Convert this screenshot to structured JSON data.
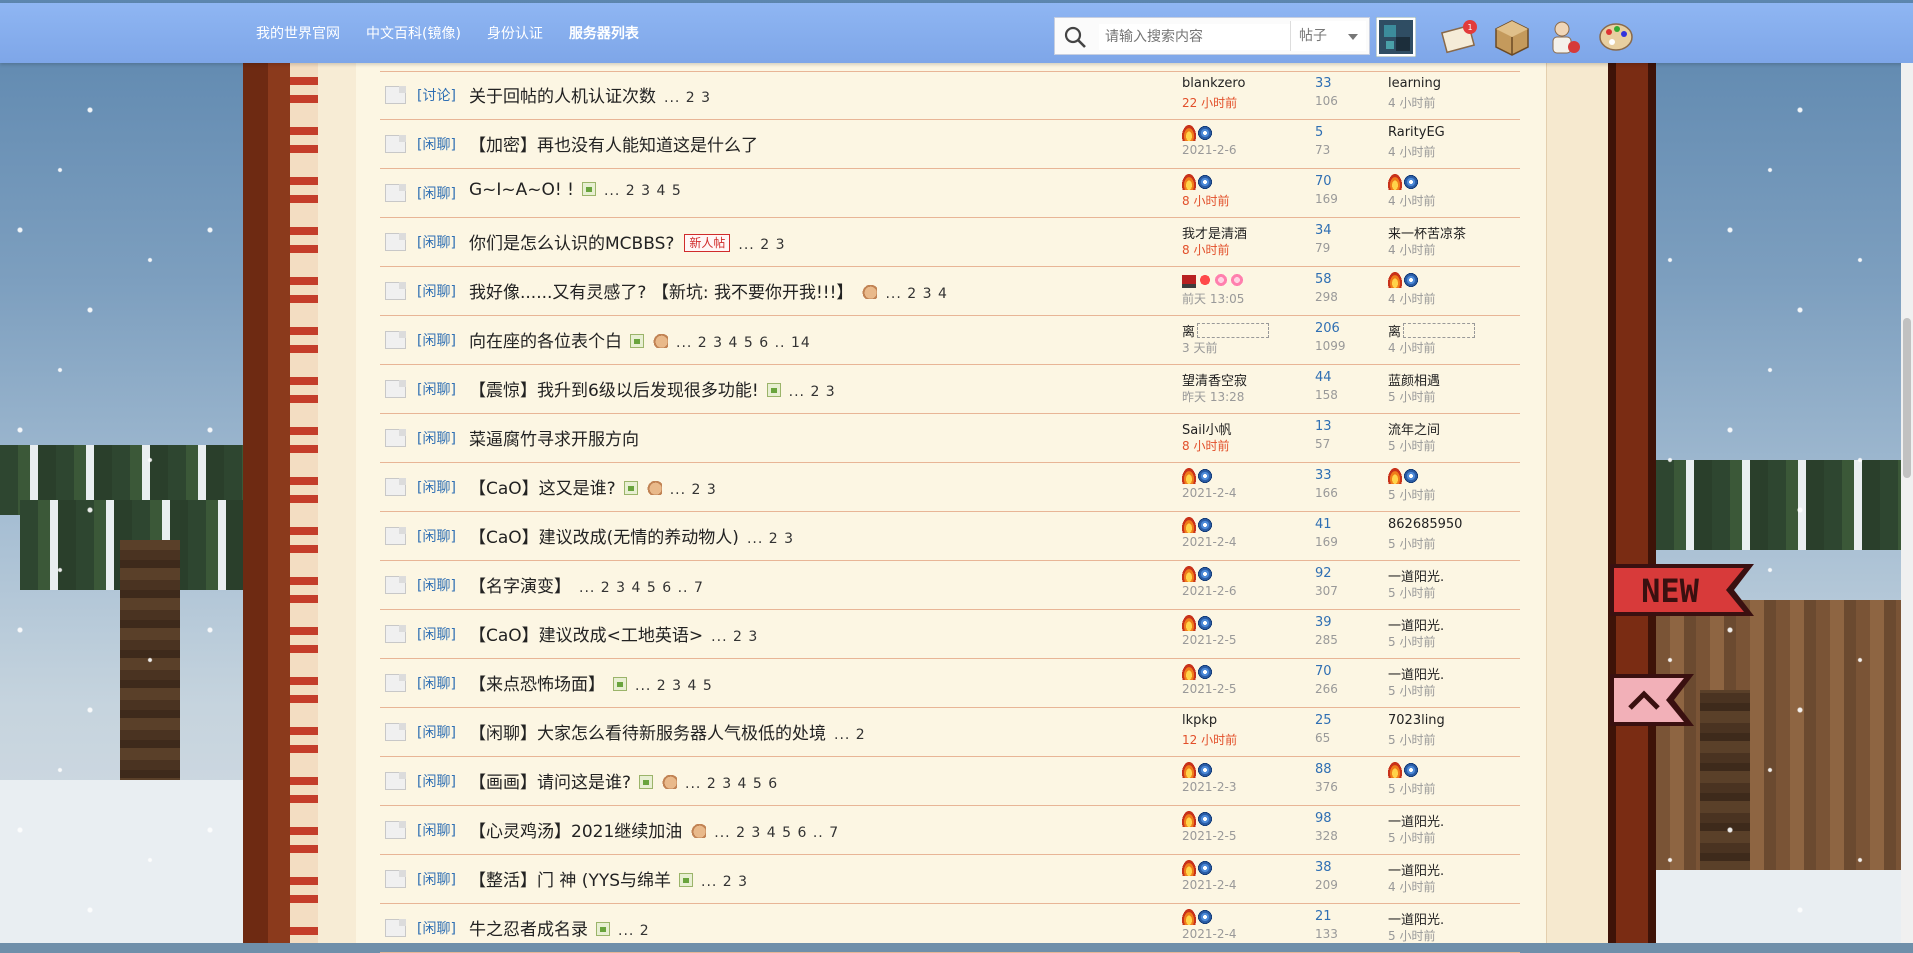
{
  "nav": {
    "links": [
      "我的世界官网",
      "中文百科(镜像)",
      "身份认证",
      "服务器列表"
    ],
    "search_placeholder": "请输入搜索内容",
    "search_type": "帖子"
  },
  "threads": [
    {
      "category": "[讨论]",
      "title": "关于回帖的人机认证次数",
      "pages": "... 2 3",
      "author": "blankzero",
      "author_date": "22 小时前",
      "author_date_red": true,
      "replies": "33",
      "views": "106",
      "last_poster": "learning",
      "last_date": "4 小时前"
    },
    {
      "category": "[闲聊]",
      "title": "【加密】再也没有人能知道这是什么了",
      "pages": "",
      "author": "",
      "author_medals": [
        "fire",
        "snow"
      ],
      "author_date": "2021-2-6",
      "author_date_red": false,
      "replies": "5",
      "views": "73",
      "last_poster": "RarityEG",
      "last_date": "4 小时前"
    },
    {
      "category": "[闲聊]",
      "title": "G~I~A~O! !",
      "img": true,
      "pages": "... 2 3 4 5",
      "author": "",
      "author_medals": [
        "fire",
        "snow"
      ],
      "author_date": "8 小时前",
      "author_date_red": true,
      "replies": "70",
      "views": "169",
      "last_poster": "",
      "last_medals": [
        "fire",
        "snow"
      ],
      "last_date": "4 小时前"
    },
    {
      "category": "[闲聊]",
      "title": "你们是怎么认识的MCBBS?",
      "newbie": "新人帖",
      "pages": "... 2 3",
      "author": "我才是清酒",
      "author_date": "8 小时前",
      "author_date_red": true,
      "replies": "34",
      "views": "79",
      "last_poster": "来一杯苦凉茶",
      "last_date": "4 小时前"
    },
    {
      "category": "[闲聊]",
      "title": "我好像......又有灵感了? 【新坑: 我不要你开我!!!】",
      "hand": true,
      "pages": "... 2 3 4",
      "author": "",
      "author_medals": [
        "boot",
        "heart",
        "flower",
        "flower"
      ],
      "author_date": "前天 13:05",
      "author_date_red": false,
      "replies": "58",
      "views": "298",
      "last_poster": "",
      "last_medals": [
        "fire",
        "snow"
      ],
      "last_date": "4 小时前"
    },
    {
      "category": "[闲聊]",
      "title": "向在座的各位表个白",
      "img": true,
      "hand": true,
      "pages": "... 2 3 4 5 6 .. 14",
      "author": "离",
      "author_boxes": true,
      "author_date": "3 天前",
      "author_date_red": false,
      "replies": "206",
      "views": "1099",
      "last_poster": "离",
      "last_boxes": true,
      "last_date": "4 小时前"
    },
    {
      "category": "[闲聊]",
      "title": "【震惊】我升到6级以后发现很多功能!",
      "img": true,
      "pages": "... 2 3",
      "author": "望清香空寂",
      "author_date": "昨天 13:28",
      "author_date_red": false,
      "replies": "44",
      "views": "158",
      "last_poster": "蓝颜相遇",
      "last_date": "5 小时前"
    },
    {
      "category": "[闲聊]",
      "title": "菜逼腐竹寻求开服方向",
      "pages": "",
      "author": "Sail小帆",
      "author_date": "8 小时前",
      "author_date_red": true,
      "replies": "13",
      "views": "57",
      "last_poster": "流年之间",
      "last_date": "5 小时前"
    },
    {
      "category": "[闲聊]",
      "title": "【CaO】这又是谁?",
      "img": true,
      "hand": true,
      "pages": "... 2 3",
      "author": "",
      "author_medals": [
        "fire",
        "snow"
      ],
      "author_date": "2021-2-4",
      "author_date_red": false,
      "replies": "33",
      "views": "166",
      "last_poster": "",
      "last_medals": [
        "fire",
        "snow"
      ],
      "last_date": "5 小时前"
    },
    {
      "category": "[闲聊]",
      "title": "【CaO】建议改成(无情的养动物人)",
      "pages": "... 2 3",
      "author": "",
      "author_medals": [
        "fire",
        "snow"
      ],
      "author_date": "2021-2-4",
      "author_date_red": false,
      "replies": "41",
      "views": "169",
      "last_poster": "862685950",
      "last_date": "5 小时前"
    },
    {
      "category": "[闲聊]",
      "title": "【名字演变】",
      "pages": "... 2 3 4 5 6 .. 7",
      "author": "",
      "author_medals": [
        "fire",
        "snow"
      ],
      "author_date": "2021-2-6",
      "author_date_red": false,
      "replies": "92",
      "views": "307",
      "last_poster": "一道阳光.",
      "last_date": "5 小时前"
    },
    {
      "category": "[闲聊]",
      "title": "【CaO】建议改成<工地英语>",
      "pages": "... 2 3",
      "author": "",
      "author_medals": [
        "fire",
        "snow"
      ],
      "author_date": "2021-2-5",
      "author_date_red": false,
      "replies": "39",
      "views": "285",
      "last_poster": "一道阳光.",
      "last_date": "5 小时前"
    },
    {
      "category": "[闲聊]",
      "title": "【来点恐怖场面】",
      "img": true,
      "pages": "... 2 3 4 5",
      "author": "",
      "author_medals": [
        "fire",
        "snow"
      ],
      "author_date": "2021-2-5",
      "author_date_red": false,
      "replies": "70",
      "views": "266",
      "last_poster": "一道阳光.",
      "last_date": "5 小时前"
    },
    {
      "category": "[闲聊]",
      "title": "【闲聊】大家怎么看待新服务器人气极低的处境",
      "pages": "... 2",
      "author": "lkpkp",
      "author_date": "12 小时前",
      "author_date_red": true,
      "replies": "25",
      "views": "65",
      "last_poster": "7023ling",
      "last_date": "5 小时前"
    },
    {
      "category": "[闲聊]",
      "title": "【画画】请问这是谁?",
      "img": true,
      "hand": true,
      "pages": "... 2 3 4 5 6",
      "author": "",
      "author_medals": [
        "fire",
        "snow"
      ],
      "author_date": "2021-2-3",
      "author_date_red": false,
      "replies": "88",
      "views": "376",
      "last_poster": "",
      "last_medals": [
        "fire",
        "snow"
      ],
      "last_date": "5 小时前"
    },
    {
      "category": "[闲聊]",
      "title": "【心灵鸡汤】2021继续加油",
      "hand": true,
      "pages": "... 2 3 4 5 6 .. 7",
      "author": "",
      "author_medals": [
        "fire",
        "snow"
      ],
      "author_date": "2021-2-5",
      "author_date_red": false,
      "replies": "98",
      "views": "328",
      "last_poster": "一道阳光.",
      "last_date": "5 小时前"
    },
    {
      "category": "[闲聊]",
      "title": "【整活】门 神 (YYS与绵羊",
      "img": true,
      "pages": "... 2 3",
      "author": "",
      "author_medals": [
        "fire",
        "snow"
      ],
      "author_date": "2021-2-4",
      "author_date_red": false,
      "replies": "38",
      "views": "209",
      "last_poster": "一道阳光.",
      "last_date": "4 小时前"
    },
    {
      "category": "[闲聊]",
      "title": "牛之忍者成名录",
      "img": true,
      "pages": "... 2",
      "author": "",
      "author_medals": [
        "fire",
        "snow"
      ],
      "author_date": "2021-2-4",
      "author_date_red": false,
      "replies": "21",
      "views": "133",
      "last_poster": "一道阳光.",
      "last_date": "5 小时前"
    }
  ],
  "side": {
    "new_label": "NEW"
  },
  "colors": {
    "nav_bg": "#8fb6f3",
    "category": "#2f6fb3",
    "date_recent": "#e24f2a",
    "row_border": "#e8b596"
  }
}
